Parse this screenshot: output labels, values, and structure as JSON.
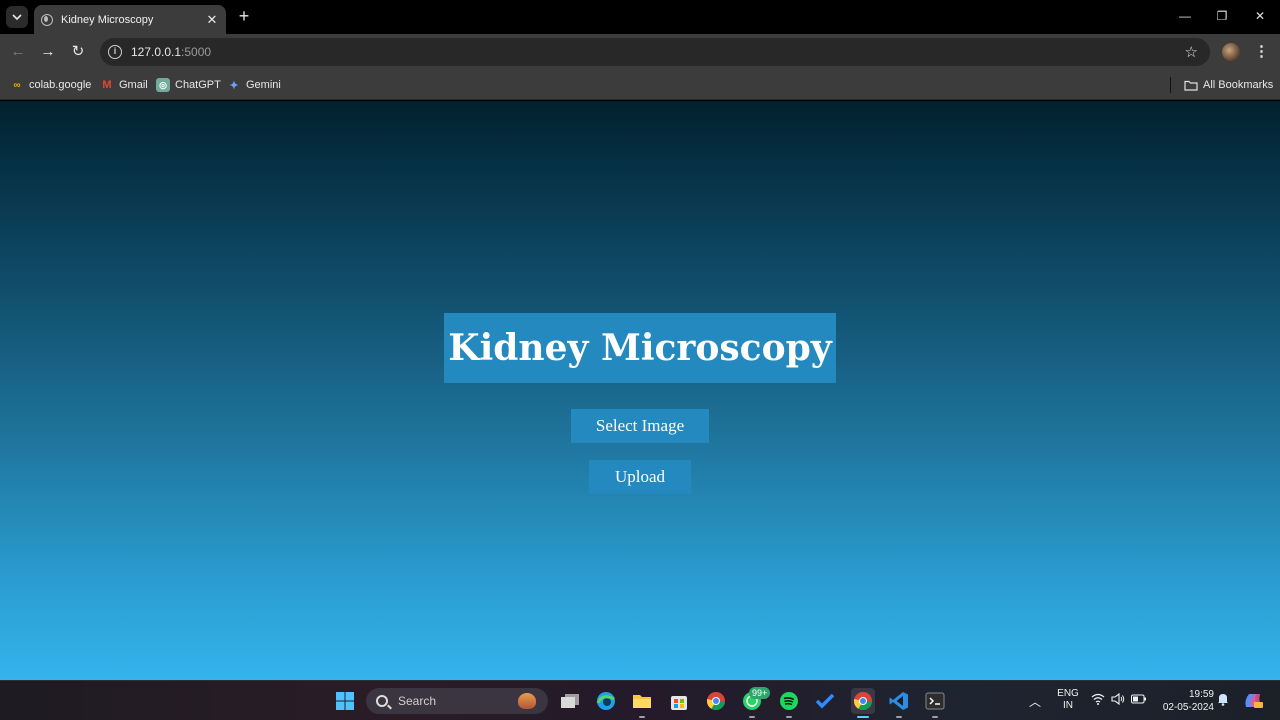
{
  "browser": {
    "tab": {
      "title": "Kidney Microscopy"
    },
    "address": {
      "host": "127.0.0.1",
      "port": ":5000"
    },
    "bookmarks": [
      {
        "label": "colab.google",
        "icon": "colab-icon"
      },
      {
        "label": "Gmail",
        "icon": "gmail-icon"
      },
      {
        "label": "ChatGPT",
        "icon": "chatgpt-icon"
      },
      {
        "label": "Gemini",
        "icon": "gemini-icon"
      }
    ],
    "all_bookmarks_label": "All Bookmarks"
  },
  "page": {
    "title": "Kidney Microscopy",
    "select_button": "Select Image",
    "upload_button": "Upload",
    "colors": {
      "panel": "#2389be",
      "gradient_top": "#01212f",
      "gradient_bottom": "#34b3ec"
    }
  },
  "taskbar": {
    "search_label": "Search",
    "whatsapp_badge": "99+",
    "language": {
      "line1": "ENG",
      "line2": "IN"
    },
    "clock": {
      "time": "19:59",
      "date": "02-05-2024"
    }
  }
}
